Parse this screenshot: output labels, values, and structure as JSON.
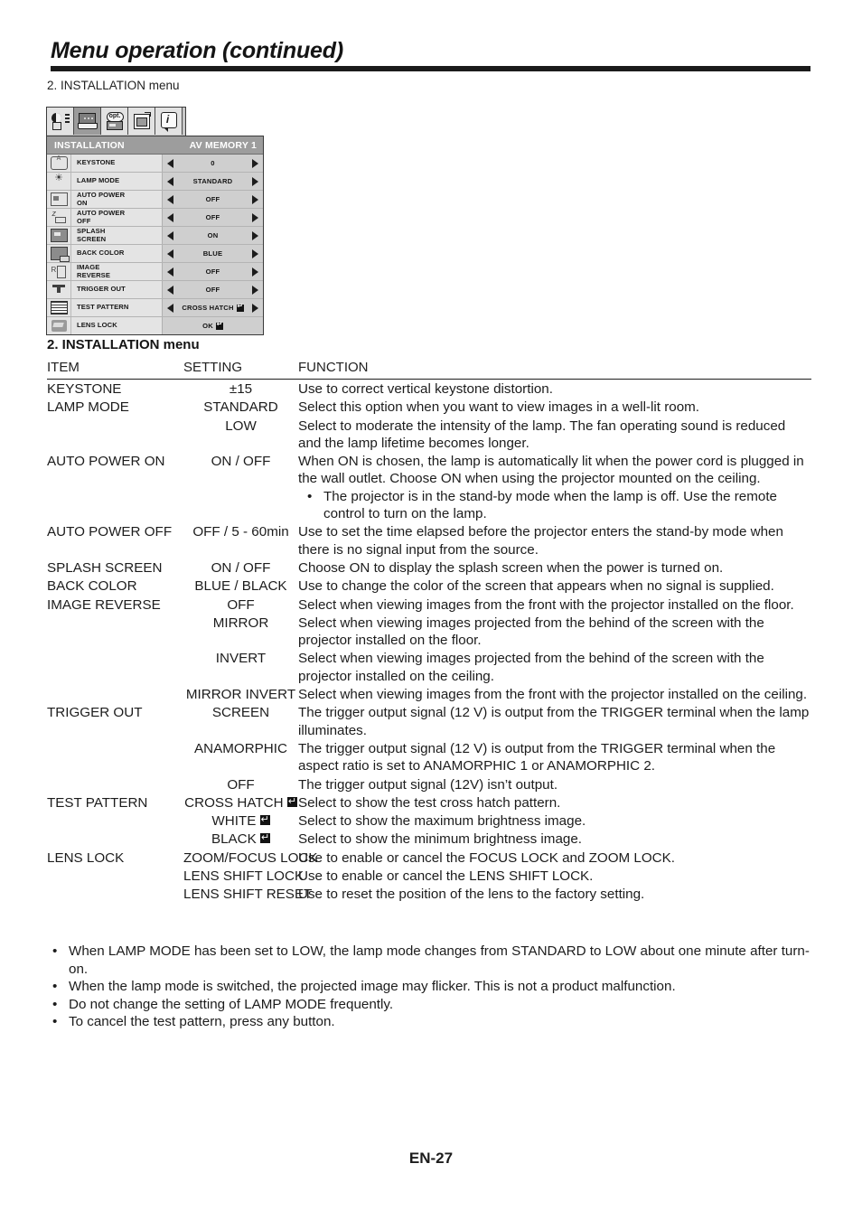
{
  "page": {
    "title": "Menu operation (continued)",
    "subhead": "2. INSTALLATION menu",
    "section_title": "2. INSTALLATION menu",
    "footer": "EN-27"
  },
  "osd": {
    "tabs": [
      {
        "name": "image-adjust-tab",
        "icon": "contrast-icon"
      },
      {
        "name": "installation-tab",
        "icon": "screen-icon"
      },
      {
        "name": "option-tab",
        "icon": "opt-icon",
        "text": "opt."
      },
      {
        "name": "signal-tab",
        "icon": "save-box-icon"
      },
      {
        "name": "information-tab",
        "icon": "info-icon",
        "text": "i"
      }
    ],
    "title": "INSTALLATION",
    "memory": "AV MEMORY 1",
    "rows": [
      {
        "icon": "keystone-icon",
        "label": "KEYSTONE",
        "value": "0",
        "arrows": true
      },
      {
        "icon": "lamp-mode-icon",
        "label": "LAMP MODE",
        "value": "STANDARD",
        "arrows": true
      },
      {
        "icon": "auto-power-on-icon",
        "label": "AUTO POWER\nON",
        "value": "OFF",
        "arrows": true
      },
      {
        "icon": "auto-power-off-icon",
        "label": "AUTO POWER\nOFF",
        "value": "OFF",
        "arrows": true
      },
      {
        "icon": "splash-screen-icon",
        "label": "SPLASH\nSCREEN",
        "value": "ON",
        "arrows": true
      },
      {
        "icon": "back-color-icon",
        "label": "BACK COLOR",
        "value": "BLUE",
        "arrows": true
      },
      {
        "icon": "image-reverse-icon",
        "label": "IMAGE\nREVERSE",
        "value": "OFF",
        "arrows": true
      },
      {
        "icon": "trigger-out-icon",
        "label": "TRIGGER OUT",
        "value": "OFF",
        "arrows": true
      },
      {
        "icon": "test-pattern-icon",
        "label": "TEST PATTERN",
        "value": "CROSS HATCH",
        "enter": true,
        "arrows": true
      },
      {
        "icon": "lens-lock-icon",
        "label": "LENS LOCK",
        "value": "OK",
        "enter": true,
        "arrows": false
      }
    ]
  },
  "table": {
    "headers": {
      "item": "ITEM",
      "setting": "SETTING",
      "function": "FUNCTION"
    },
    "rows": [
      {
        "item": "KEYSTONE",
        "setting": "±15",
        "function": "Use to correct vertical keystone distortion."
      },
      {
        "item": "LAMP MODE",
        "setting": "STANDARD",
        "function": "Select this option when you want to view images in a well-lit room."
      },
      {
        "item": "",
        "setting": "LOW",
        "function": "Select to moderate the intensity of the lamp. The fan operating sound is reduced and the lamp lifetime becomes longer."
      },
      {
        "item": "AUTO POWER ON",
        "setting": "ON / OFF",
        "function": "When ON is chosen, the lamp is automatically lit when the power cord is plugged in the wall outlet. Choose ON when using the projector mounted on the ceiling.",
        "bullet": "The projector is in the stand-by mode when the lamp is off. Use the remote control to turn on the lamp."
      },
      {
        "item": "AUTO POWER OFF",
        "setting": "OFF / 5 - 60min",
        "function": "Use to set the time elapsed before the projector enters the stand-by mode when there is no signal input from the source."
      },
      {
        "item": "SPLASH SCREEN",
        "setting": "ON / OFF",
        "function": "Choose ON to display the splash screen when the power is turned on."
      },
      {
        "item": "BACK COLOR",
        "setting": "BLUE / BLACK",
        "function": "Use to change the color of the screen that appears when no signal is supplied."
      },
      {
        "item": "IMAGE REVERSE",
        "setting": "OFF",
        "function": "Select when viewing images from the front with the projector installed on the floor."
      },
      {
        "item": "",
        "setting": "MIRROR",
        "function": "Select when viewing images projected from the behind of the screen with the projector installed on the floor."
      },
      {
        "item": "",
        "setting": "INVERT",
        "function": "Select when viewing images projected from the behind of the screen with the projector installed on the ceiling."
      },
      {
        "item": "",
        "setting": "MIRROR INVERT",
        "function": "Select when viewing images from the front with the projector installed on the ceiling."
      },
      {
        "item": "TRIGGER OUT",
        "setting": "SCREEN",
        "function": "The trigger output signal (12 V) is output from the TRIGGER terminal when the lamp illuminates."
      },
      {
        "item": "",
        "setting": "ANAMORPHIC",
        "function": "The trigger output signal (12 V) is output from the TRIGGER terminal when the aspect ratio is set to ANAMORPHIC 1 or ANAMORPHIC 2."
      },
      {
        "item": "",
        "setting": "OFF",
        "function": "The trigger output signal (12V) isn’t output."
      },
      {
        "item": "TEST PATTERN",
        "setting": "CROSS HATCH",
        "setting_enter": true,
        "function": "Select to show the test cross hatch pattern."
      },
      {
        "item": "",
        "setting": "WHITE",
        "setting_enter": true,
        "function": "Select to show the maximum brightness image."
      },
      {
        "item": "",
        "setting": "BLACK",
        "setting_enter": true,
        "function": "Select to show the minimum brightness image."
      },
      {
        "item": "LENS LOCK",
        "setting": "ZOOM/FOCUS LOCK",
        "function": "Use to enable or cancel the FOCUS LOCK and ZOOM LOCK."
      },
      {
        "item": "",
        "setting": "LENS SHIFT LOCK",
        "function": "Use to enable or cancel the LENS SHIFT LOCK."
      },
      {
        "item": "",
        "setting": "LENS SHIFT RESET",
        "function": "Use to reset the position of the lens to the factory setting."
      }
    ]
  },
  "notes": [
    "When LAMP MODE has been set to LOW, the lamp mode changes from STANDARD to LOW about one minute after turn-on.",
    "When the lamp mode is switched, the projected image may flicker. This is not a product malfunction.",
    "Do not change the setting of LAMP MODE frequently.",
    "To cancel the test pattern, press any button."
  ]
}
